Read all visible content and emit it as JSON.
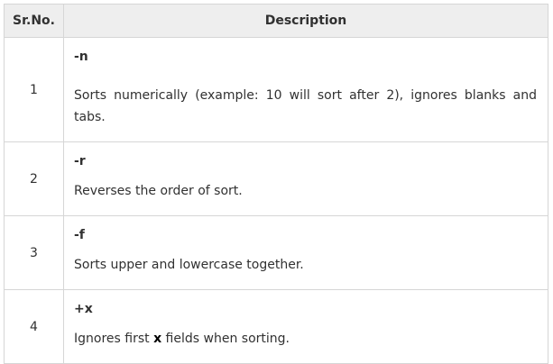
{
  "table": {
    "headers": {
      "sr_no": "Sr.No.",
      "description": "Description"
    },
    "rows": [
      {
        "number": "1",
        "option": "-n",
        "description": "Sorts numerically (example: 10 will sort after 2), ignores blanks and tabs."
      },
      {
        "number": "2",
        "option": "-r",
        "description": "Reverses the order of sort."
      },
      {
        "number": "3",
        "option": "-f",
        "description": "Sorts upper and lowercase together."
      },
      {
        "number": "4",
        "option": "+x",
        "description_before": "Ignores first ",
        "description_bold": "x",
        "description_after": " fields when sorting."
      }
    ]
  },
  "colors": {
    "header_background": "#eeeeee",
    "border": "#d6d6d6",
    "text": "#313131"
  }
}
